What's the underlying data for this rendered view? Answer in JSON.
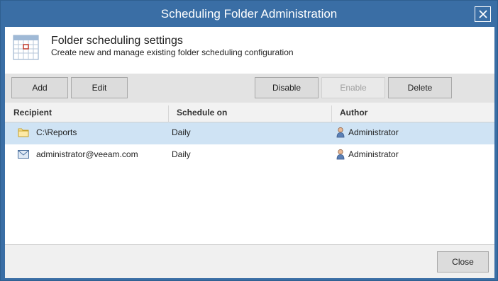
{
  "window": {
    "title": "Scheduling Folder Administration"
  },
  "header": {
    "title": "Folder scheduling settings",
    "subtitle": "Create new and manage existing folder scheduling configuration"
  },
  "toolbar": {
    "add": "Add",
    "edit": "Edit",
    "disable": "Disable",
    "enable": "Enable",
    "delete": "Delete"
  },
  "grid": {
    "columns": [
      "Recipient",
      "Schedule on",
      "Author"
    ],
    "rows": [
      {
        "icon": "folder-icon",
        "recipient": "C:\\Reports",
        "schedule": "Daily",
        "author": "Administrator",
        "selected": true
      },
      {
        "icon": "mail-icon",
        "recipient": "administrator@veeam.com",
        "schedule": "Daily",
        "author": "Administrator",
        "selected": false
      }
    ]
  },
  "footer": {
    "close": "Close"
  },
  "colors": {
    "titlebar": "#3a6ea5",
    "selection": "#cfe3f4",
    "toolbar": "#e3e3e3"
  }
}
